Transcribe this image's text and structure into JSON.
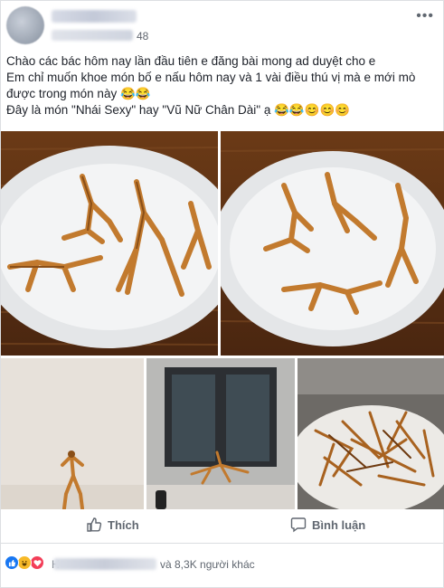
{
  "post": {
    "time_suffix": "48",
    "more_icon": "more-horizontal-icon",
    "lines": [
      "Chào các bác hôm nay lần đầu tiên e đăng bài mong ad duyệt cho e",
      "Em chỉ muốn khoe món bố e nấu hôm nay và 1 vài điều thú vị mà e mới mò",
      "được trong món này 😂😂",
      "Đây là món \"Nhái Sexy\" hay \"Vũ Nữ Chân Dài\" ạ 😂😂😊😊😊"
    ]
  },
  "actions": {
    "like_label": "Thích",
    "comment_label": "Bình luận"
  },
  "reactions": {
    "icons": [
      "like-icon",
      "haha-icon",
      "love-icon"
    ],
    "name_initial": "H",
    "others_text": "và 8,3K người khác"
  },
  "colors": {
    "like_blue": "#1877f2",
    "haha_yellow": "#f7b928",
    "love_red": "#f33e58",
    "text": "#1d2129",
    "muted": "#606770"
  }
}
